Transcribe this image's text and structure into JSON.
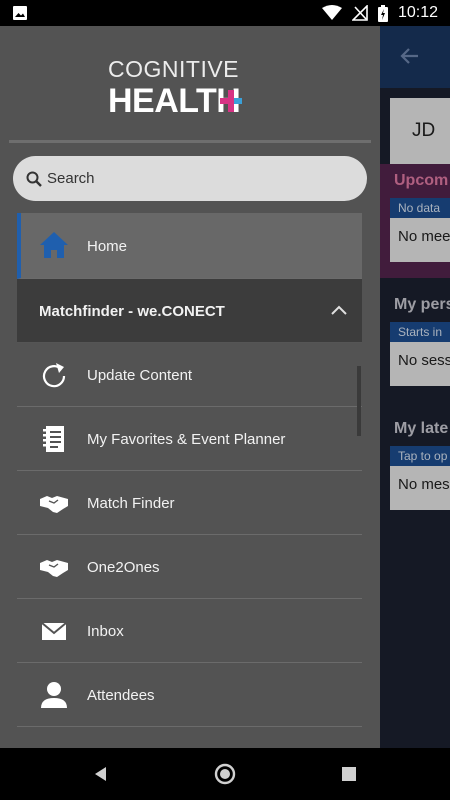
{
  "status_bar": {
    "time": "10:12",
    "icons": [
      "image-icon",
      "wifi-icon",
      "no-signal-icon",
      "battery-icon"
    ]
  },
  "drawer": {
    "logo": {
      "line1": "COGNITIVE",
      "line2": "HEALTH"
    },
    "search": {
      "placeholder": "Search"
    },
    "items": [
      {
        "label": "Home",
        "icon": "home-icon",
        "selected": true
      },
      {
        "label": "Matchfinder - we.CONECT",
        "type": "section",
        "expanded": true
      },
      {
        "label": "Update Content",
        "icon": "refresh-icon"
      },
      {
        "label": "My Favorites & Event Planner",
        "icon": "notebook-icon"
      },
      {
        "label": "Match Finder",
        "icon": "handshake-icon"
      },
      {
        "label": "One2Ones",
        "icon": "handshake-icon"
      },
      {
        "label": "Inbox",
        "icon": "mail-icon"
      },
      {
        "label": "Attendees",
        "icon": "person-icon"
      }
    ]
  },
  "background_screen": {
    "avatar_initials": "JD",
    "sections": [
      {
        "heading": "Upcom",
        "tag": "No data",
        "box": "No mee"
      },
      {
        "heading": "My pers",
        "tag": "Starts in",
        "box": "No sess"
      },
      {
        "heading": "My late",
        "tag": "Tap to op",
        "box": "No mes"
      }
    ]
  },
  "colors": {
    "drawer_bg": "#535353",
    "selected_accent": "#1f5fae",
    "section_bg": "#3c3c3c",
    "toolbar_bg": "#1a3660",
    "logo_plus": "#d63384"
  }
}
